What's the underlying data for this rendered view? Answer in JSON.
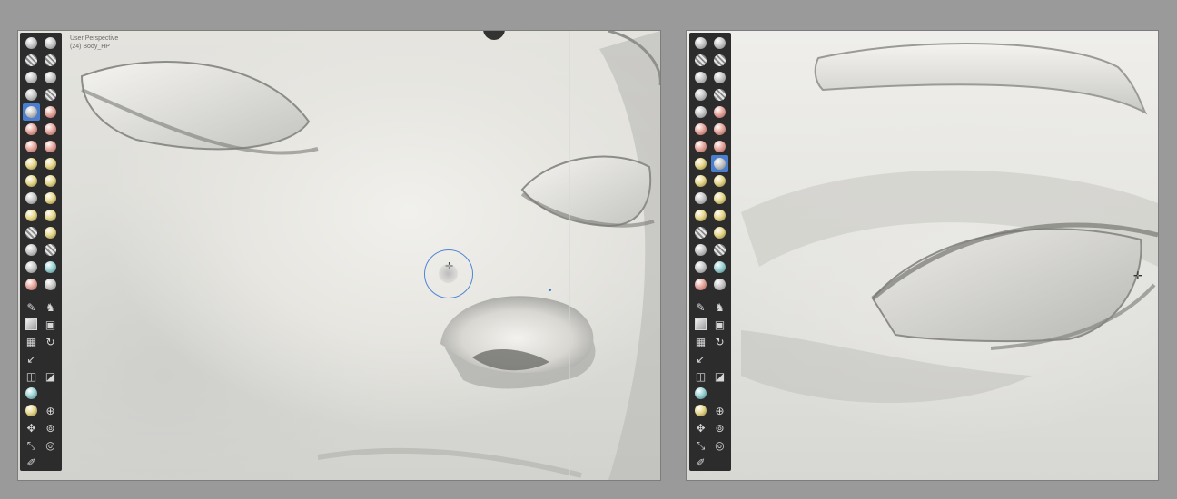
{
  "viewport_left": {
    "info_line1": "User Perspective",
    "info_line2": "(24) Body_HP"
  },
  "toolbar": {
    "brush_rows": [
      [
        "plain",
        "plain"
      ],
      [
        "striped",
        "striped"
      ],
      [
        "plain",
        "plain"
      ],
      [
        "plain",
        "striped"
      ],
      [
        "active",
        "red"
      ],
      [
        "red",
        "red"
      ],
      [
        "red",
        "red"
      ],
      [
        "yellow",
        "yellow"
      ],
      [
        "yellow",
        "yellow"
      ],
      [
        "plain",
        "yellow"
      ],
      [
        "yellow",
        "yellow"
      ],
      [
        "striped",
        "yellow"
      ],
      [
        "plain",
        "striped"
      ],
      [
        "plain",
        "cyan"
      ],
      [
        "red",
        "plain"
      ]
    ],
    "icons": [
      "draw-icon",
      "knight-icon",
      "box-select-icon",
      "box-square-icon",
      "cube-icon",
      "rotate-icon",
      "arrow-icon",
      "mesh-icon",
      "mesh-alt-icon",
      "cyan-mesh-icon",
      "render-icon",
      "search-icon",
      "move-icon",
      "orbit-icon",
      "scale-icon",
      "target-icon",
      "annotate-icon"
    ]
  },
  "colors": {
    "background": "#9a9a9a",
    "toolbar": "#2c2c2c",
    "active_tool": "#4a7fd0",
    "brush_cursor": "#4f86d4"
  }
}
